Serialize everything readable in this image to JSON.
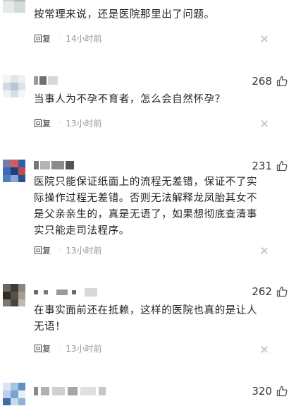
{
  "comments": [
    {
      "text": "按常理来说，还是医院那里出了问题。",
      "reply_label": "回复",
      "time": "14小时前",
      "likes": ""
    },
    {
      "text": "当事人为不孕不育者，怎么会自然怀孕？",
      "reply_label": "回复",
      "time": "13小时前",
      "likes": "268"
    },
    {
      "text": "医院只能保证纸面上的流程无差错，保证不了实际操作过程无差错。否则无法解释龙凤胎其女不是父亲亲生的，真是无语了，如果想彻底查清事实只能走司法程序。",
      "reply_label": "回复",
      "time": "13小时前",
      "likes": "231"
    },
    {
      "text": "在事实面前还在抵赖，这样的医院也真的是让人无语！",
      "reply_label": "回复",
      "time": "13小时前",
      "likes": "262"
    },
    {
      "text": "",
      "reply_label": "",
      "time": "",
      "likes": "320"
    }
  ],
  "icons": {
    "like": "thumbs-up-icon",
    "dismiss": "close-icon"
  },
  "colors": {
    "text": "#222222",
    "muted": "#999999",
    "icon": "#555555"
  }
}
